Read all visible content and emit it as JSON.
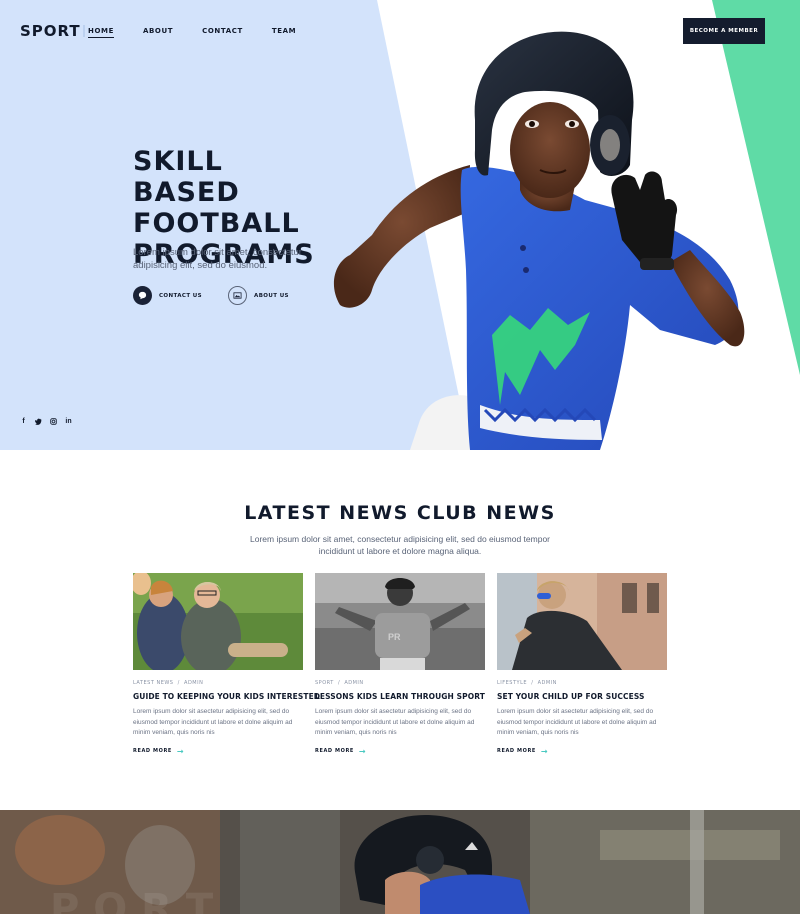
{
  "brand": {
    "logo_text": "SPORT"
  },
  "nav": {
    "items": [
      {
        "label": "HOME",
        "active": true
      },
      {
        "label": "ABOUT",
        "active": false
      },
      {
        "label": "CONTACT",
        "active": false
      },
      {
        "label": "TEAM",
        "active": false
      }
    ]
  },
  "header": {
    "cta_label": "BECOME A MEMBER"
  },
  "hero": {
    "title_lines": [
      "SKILL BASED",
      "FOOTBALL",
      "PROGRAMS"
    ],
    "subtitle": "Lorem ipsum dolor sit amet, consectetur adipisicing elit, sed do eiusmod.",
    "actions": [
      {
        "label": "CONTACT US",
        "icon": "chat-icon"
      },
      {
        "label": "ABOUT US",
        "icon": "image-icon"
      }
    ],
    "social": [
      {
        "glyph": "f",
        "icon": "facebook-icon"
      },
      {
        "glyph": "t",
        "icon": "twitter-icon"
      },
      {
        "glyph": "◎",
        "icon": "instagram-icon"
      },
      {
        "glyph": "in",
        "icon": "linkedin-icon"
      }
    ]
  },
  "news": {
    "title": "LATEST NEWS CLUB NEWS",
    "subtitle": "Lorem ipsum dolor sit amet, consectetur adipisicing elit, sed do eiusmod tempor incididunt ut labore et dolore magna aliqua.",
    "cards": [
      {
        "category": "LATEST NEWS",
        "author": "ADMIN",
        "title": "GUIDE TO KEEPING YOUR KIDS INTERESTED",
        "text": "Lorem ipsum dolor sit asectetur adipisicing elit, sed do eiusmod tempor incididunt ut labore et dolne aliquim ad minim veniam, quis noris nis",
        "more": "READ MORE"
      },
      {
        "category": "SPORT",
        "author": "ADMIN",
        "title": "LESSONS KIDS LEARN THROUGH SPORT",
        "text": "Lorem ipsum dolor sit asectetur adipisicing elit, sed do eiusmod tempor incididunt ut labore et dolne aliquim ad minim veniam, quis noris nis",
        "more": "READ MORE"
      },
      {
        "category": "LIFESTYLE",
        "author": "ADMIN",
        "title": "SET YOUR CHILD UP FOR SUCCESS",
        "text": "Lorem ipsum dolor sit asectetur adipisicing elit, sed do eiusmod tempor incididunt ut labore et dolne aliquim ad minim veniam, quis noris nis",
        "more": "READ MORE"
      }
    ]
  },
  "colors": {
    "hero_blue": "#d3e3fb",
    "accent_green": "#5fdba6",
    "navy": "#141c2e",
    "teal_arrow": "#4ac9c1",
    "jersey_blue": "#2f5fd6"
  }
}
